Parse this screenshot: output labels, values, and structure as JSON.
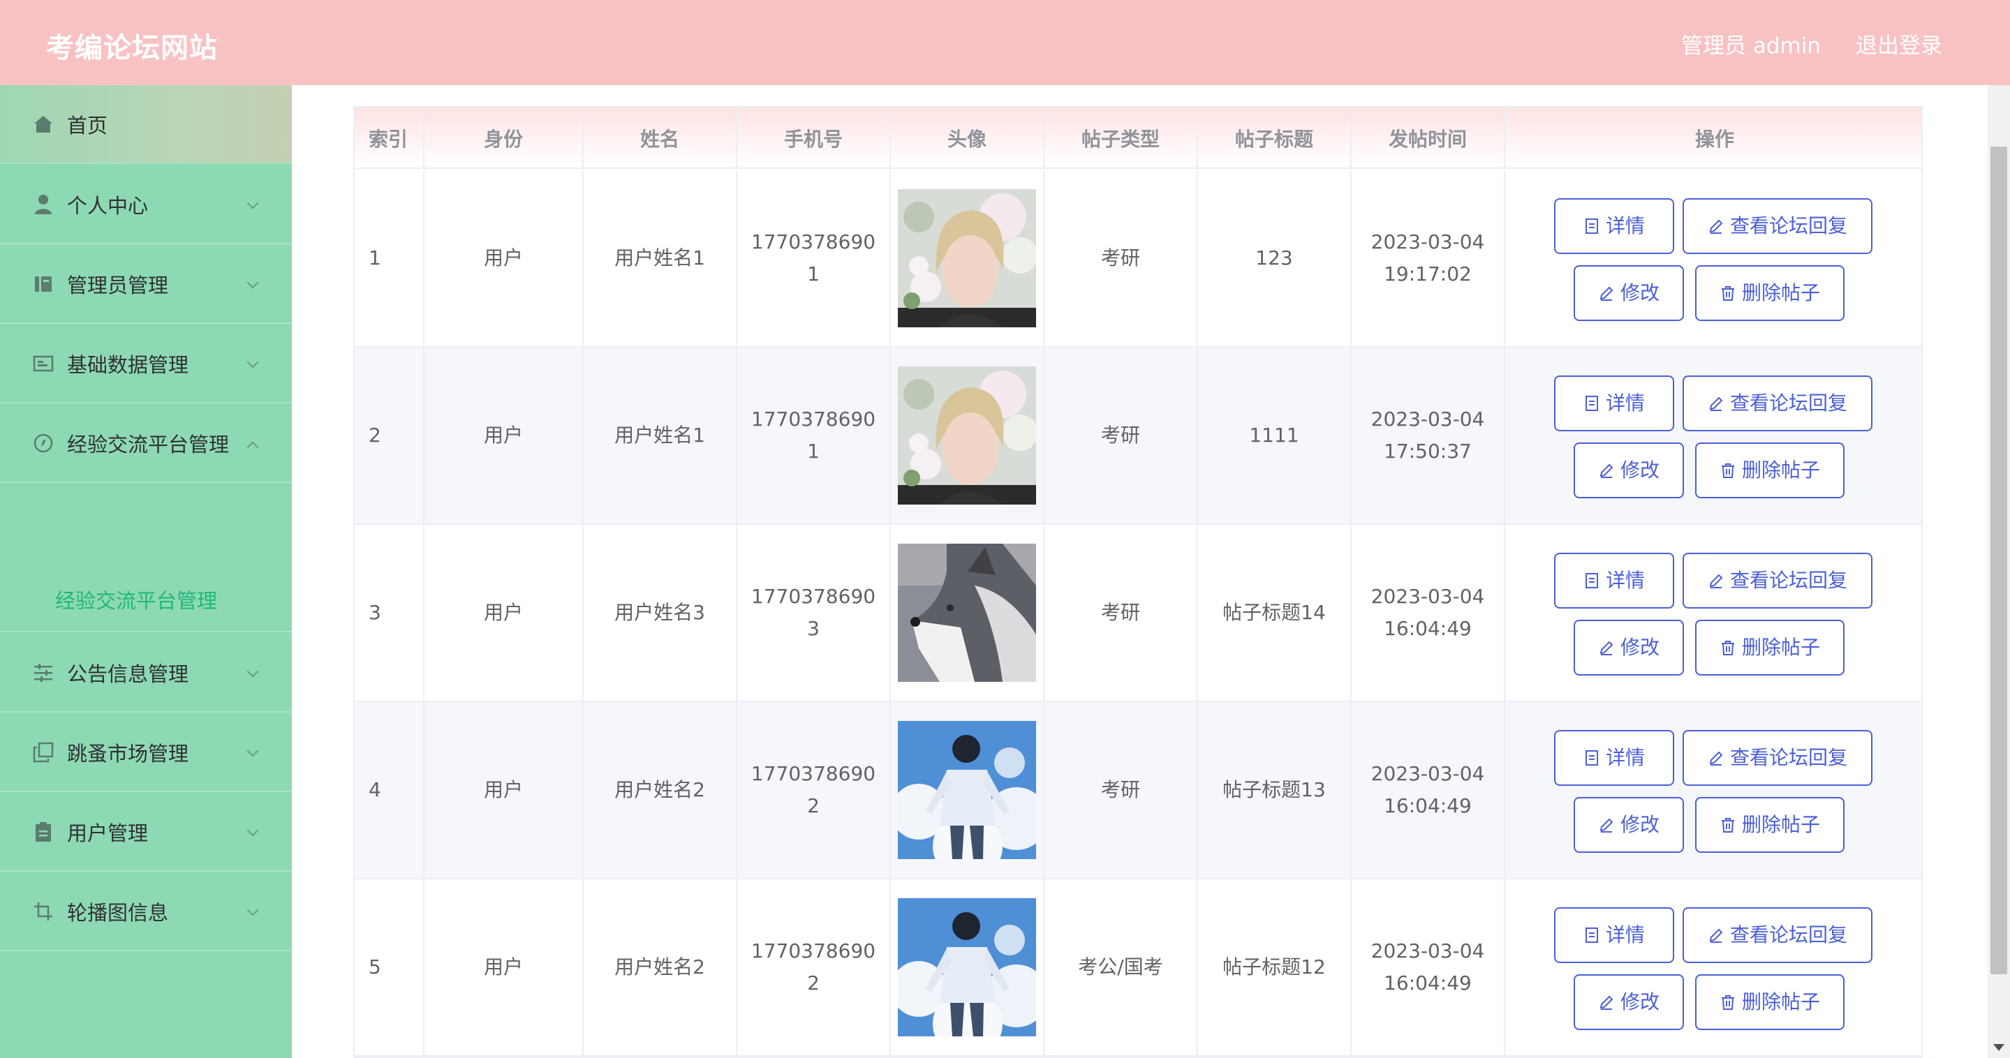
{
  "header": {
    "site_title": "考编论坛网站",
    "user_label": "管理员 admin",
    "logout_label": "退出登录"
  },
  "sidebar": {
    "items": [
      {
        "label": "首页",
        "icon": "home-icon"
      },
      {
        "label": "个人中心",
        "icon": "user-icon"
      },
      {
        "label": "管理员管理",
        "icon": "admin-icon"
      },
      {
        "label": "基础数据管理",
        "icon": "card-icon"
      },
      {
        "label": "经验交流平台管理",
        "icon": "compass-icon"
      },
      {
        "label": "公告信息管理",
        "icon": "sliders-icon"
      },
      {
        "label": "跳蚤市场管理",
        "icon": "copy-icon"
      },
      {
        "label": "用户管理",
        "icon": "clipboard-icon"
      },
      {
        "label": "轮播图信息",
        "icon": "crop-icon"
      }
    ],
    "active_sub": "经验交流平台管理"
  },
  "table": {
    "columns": [
      "索引",
      "身份",
      "姓名",
      "手机号",
      "头像",
      "帖子类型",
      "帖子标题",
      "发帖时间",
      "操作"
    ],
    "rows": [
      {
        "index": "1",
        "role": "用户",
        "name": "用户姓名1",
        "phone_a": "1770378690",
        "phone_b": "1",
        "avatar": "avatar-flowers",
        "type": "考研",
        "title": "123",
        "date": "2023-03-04",
        "time": "19:17:02"
      },
      {
        "index": "2",
        "role": "用户",
        "name": "用户姓名1",
        "phone_a": "1770378690",
        "phone_b": "1",
        "avatar": "avatar-flowers",
        "type": "考研",
        "title": "1111",
        "date": "2023-03-04",
        "time": "17:50:37"
      },
      {
        "index": "3",
        "role": "用户",
        "name": "用户姓名3",
        "phone_a": "1770378690",
        "phone_b": "3",
        "avatar": "avatar-husky",
        "type": "考研",
        "title": "帖子标题14",
        "date": "2023-03-04",
        "time": "16:04:49"
      },
      {
        "index": "4",
        "role": "用户",
        "name": "用户姓名2",
        "phone_a": "1770378690",
        "phone_b": "2",
        "avatar": "avatar-sky",
        "type": "考研",
        "title": "帖子标题13",
        "date": "2023-03-04",
        "time": "16:04:49"
      },
      {
        "index": "5",
        "role": "用户",
        "name": "用户姓名2",
        "phone_a": "1770378690",
        "phone_b": "2",
        "avatar": "avatar-sky",
        "type": "考公/国考",
        "title": "帖子标题12",
        "date": "2023-03-04",
        "time": "16:04:49"
      }
    ],
    "actions": {
      "detail": "详情",
      "view_replies": "查看论坛回复",
      "edit": "修改",
      "delete": "删除帖子"
    }
  },
  "colors": {
    "header_bg": "#f8c2c3",
    "sidebar_bg": "#8dd9b4",
    "active_sub": "#1fb87a",
    "button_border": "#4b5fd8"
  }
}
